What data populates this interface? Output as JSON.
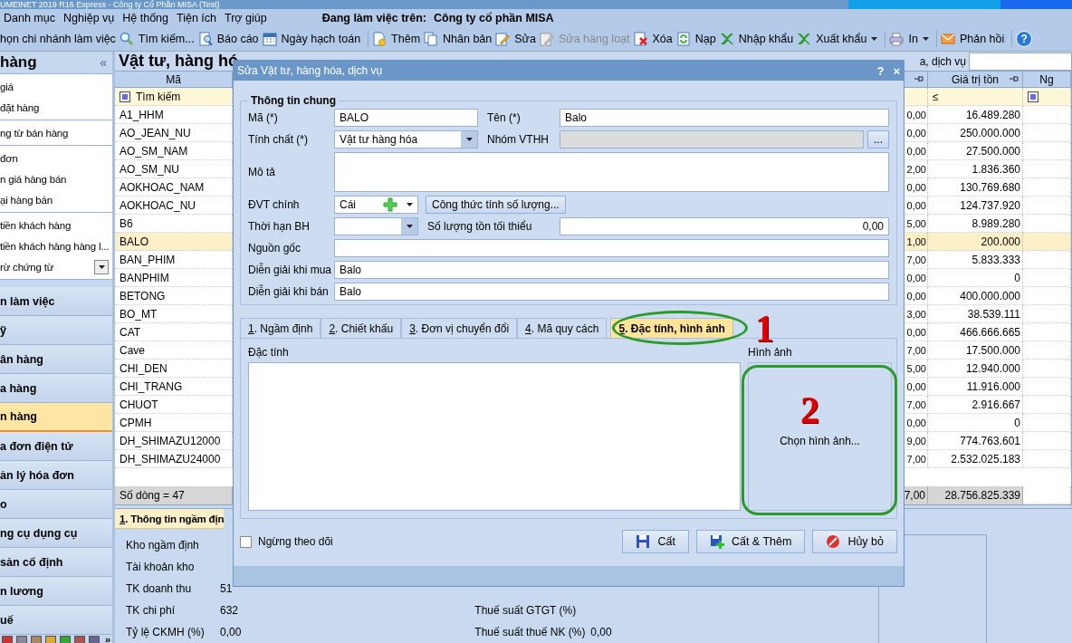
{
  "window": {
    "title": "UMEINET 2019 R16 Express - Công ty Cổ Phần MISA (Test)"
  },
  "menu": {
    "items": [
      "Danh mục",
      "Nghiệp vụ",
      "Hệ thống",
      "Tiện ích",
      "Trợ giúp"
    ],
    "working_label": "Đang làm việc trên:",
    "company": "Công ty cổ phần MISA"
  },
  "toolbar": {
    "items": [
      {
        "label": "họn chi nhánh làm việc",
        "disabled": false,
        "dropdown": false
      },
      {
        "label": "Tìm kiếm...",
        "disabled": false,
        "dropdown": false
      },
      {
        "label": "Báo cáo",
        "disabled": false,
        "dropdown": false
      },
      {
        "label": "Ngày hạch toán",
        "disabled": false,
        "dropdown": false
      },
      {
        "label": "Thêm",
        "disabled": false,
        "dropdown": false
      },
      {
        "label": "Nhân bản",
        "disabled": false,
        "dropdown": false
      },
      {
        "label": "Sửa",
        "disabled": false,
        "dropdown": false
      },
      {
        "label": "Sửa hàng loạt",
        "disabled": true,
        "dropdown": false
      },
      {
        "label": "Xóa",
        "disabled": false,
        "dropdown": false
      },
      {
        "label": "Nạp",
        "disabled": false,
        "dropdown": false
      },
      {
        "label": "Nhập khẩu",
        "disabled": false,
        "dropdown": false
      },
      {
        "label": "Xuất khẩu",
        "disabled": false,
        "dropdown": true
      },
      {
        "label": "In",
        "disabled": false,
        "dropdown": true
      },
      {
        "label": "Phản hồi",
        "disabled": false,
        "dropdown": false
      }
    ],
    "help": "?"
  },
  "sidebar": {
    "title": "hàng",
    "collapse": "«",
    "groups": [
      [
        "giá",
        "đặt hàng"
      ],
      [
        "ng từ bán hàng"
      ],
      [
        "đơn",
        "n giá hàng bán",
        "ại hàng bán"
      ],
      [
        "tiền khách hàng",
        "tiền khách hàng hàng l...",
        "rừ chứng từ"
      ]
    ],
    "nav": [
      {
        "label": "n làm việc",
        "selected": false
      },
      {
        "label": "ỹ",
        "selected": false
      },
      {
        "label": "ân hàng",
        "selected": false
      },
      {
        "label": "a hàng",
        "selected": false
      },
      {
        "label": "n hàng",
        "selected": true
      },
      {
        "label": "a đơn điện tử",
        "selected": false
      },
      {
        "label": "ản lý hóa đơn",
        "selected": false
      },
      {
        "label": "o",
        "selected": false
      },
      {
        "label": "ng cụ dụng cụ",
        "selected": false
      },
      {
        "label": "sản cố định",
        "selected": false
      },
      {
        "label": "n lương",
        "selected": false
      },
      {
        "label": "uế",
        "selected": false
      }
    ],
    "more": "»"
  },
  "grid": {
    "title": "Vật tư, hàng hó",
    "search_label": "a, dịch vụ",
    "columns": [
      "Mã",
      "Giá trị tồn",
      "Ng"
    ],
    "filter": {
      "search": "Tìm kiếm",
      "operator": "≤"
    },
    "rows": [
      {
        "code": "A1_HHM",
        "qty": "0,00",
        "value": "16.489.280",
        "selected": false
      },
      {
        "code": "AO_JEAN_NU",
        "qty": "0,00",
        "value": "250.000.000",
        "selected": false
      },
      {
        "code": "AO_SM_NAM",
        "qty": "0,00",
        "value": "27.500.000",
        "selected": false
      },
      {
        "code": "AO_SM_NU",
        "qty": "2,00",
        "value": "1.836.360",
        "selected": false
      },
      {
        "code": "AOKHOAC_NAM",
        "qty": "0,00",
        "value": "130.769.680",
        "selected": false
      },
      {
        "code": "AOKHOAC_NU",
        "qty": "0,00",
        "value": "124.737.920",
        "selected": false
      },
      {
        "code": "B6",
        "qty": "5,00",
        "value": "8.989.280",
        "selected": false
      },
      {
        "code": "BALO",
        "qty": "1,00",
        "value": "200.000",
        "selected": true
      },
      {
        "code": "BAN_PHIM",
        "qty": "7,00",
        "value": "5.833.333",
        "selected": false
      },
      {
        "code": "BANPHIM",
        "qty": "0,00",
        "value": "0",
        "selected": false
      },
      {
        "code": "BETONG",
        "qty": "0,00",
        "value": "400.000.000",
        "selected": false
      },
      {
        "code": "BO_MT",
        "qty": "3,00",
        "value": "38.539.111",
        "selected": false
      },
      {
        "code": "CAT",
        "qty": "0,00",
        "value": "466.666.665",
        "selected": false
      },
      {
        "code": "Cave",
        "qty": "7,00",
        "value": "17.500.000",
        "selected": false
      },
      {
        "code": "CHI_DEN",
        "qty": "5,00",
        "value": "12.940.000",
        "selected": false
      },
      {
        "code": "CHI_TRANG",
        "qty": "0,00",
        "value": "11.916.000",
        "selected": false
      },
      {
        "code": "CHUOT",
        "qty": "7,00",
        "value": "2.916.667",
        "selected": false
      },
      {
        "code": "CPMH",
        "qty": "0,00",
        "value": "0",
        "selected": false
      },
      {
        "code": "DH_SHIMAZU12000",
        "qty": "9,00",
        "value": "774.763.601",
        "selected": false
      },
      {
        "code": "DH_SHIMAZU24000",
        "qty": "7,00",
        "value": "2.532.025.183",
        "selected": false
      }
    ],
    "footer": {
      "count": "Số dòng = 47",
      "qty": "7,00",
      "value": "28.756.825.339"
    }
  },
  "detail": {
    "tab": "1. Thông tin ngầm địn",
    "left": [
      {
        "label": "Kho ngầm định"
      },
      {
        "label": "Tài khoản kho"
      },
      {
        "label": "TK doanh thu",
        "value": "51"
      },
      {
        "label": "TK chi phí",
        "value": "632"
      },
      {
        "label": "Tỷ lệ CKMH (%)",
        "value": "0,00"
      }
    ],
    "right": [
      {
        "label": "Thuế suất GTGT (%)"
      },
      {
        "label": "Thuế suất thuế NK (%)",
        "value": "0,00"
      }
    ]
  },
  "dialog": {
    "title": "Sửa Vật tư, hàng hóa, dịch vụ",
    "help": "?",
    "close": "×",
    "group": "Thông tin chung",
    "rows": [
      [
        {
          "label": "Mã (*)",
          "value": "BALO",
          "kind": "text"
        },
        {
          "label": "Tên (*)",
          "value": "Balo",
          "kind": "text"
        }
      ],
      [
        {
          "label": "Tính chất (*)",
          "value": "Vật tư hàng hóa",
          "kind": "combo"
        },
        {
          "label": "Nhóm VTHH",
          "kind": "picker",
          "button": "..."
        }
      ],
      [
        {
          "label": "Mô tả",
          "kind": "memo"
        }
      ],
      [
        {
          "label": "ĐVT chính",
          "value": "Cái",
          "kind": "unit"
        },
        {
          "button": "Công thức tính số lượng...",
          "kind": "button"
        }
      ],
      [
        {
          "label": "Thời hạn BH",
          "kind": "combo"
        },
        {
          "label": "Số lượng tồn tối thiểu",
          "value": "0,00",
          "kind": "number"
        }
      ],
      [
        {
          "label": "Nguồn gốc",
          "kind": "text"
        }
      ],
      [
        {
          "label": "Diễn giải khi mua",
          "value": "Balo",
          "kind": "text"
        }
      ],
      [
        {
          "label": "Diễn giải khi bán",
          "value": "Balo",
          "kind": "text"
        }
      ]
    ],
    "tabs": [
      {
        "label": "1. Ngầm định",
        "selected": false
      },
      {
        "label": "2. Chiết khấu",
        "selected": false
      },
      {
        "label": "3. Đơn vị chuyển đổi",
        "selected": false
      },
      {
        "label": "4. Mã quy cách",
        "selected": false
      },
      {
        "label": "5. Đặc tính, hình ảnh",
        "selected": true
      }
    ],
    "traits_label": "Đặc tính",
    "image_label": "Hình ảnh",
    "image_button": "Chọn hình ảnh...",
    "inactive": {
      "label": "Ngừng theo dõi",
      "checked": false
    },
    "buttons": [
      {
        "label": "Cất"
      },
      {
        "label": "Cất & Thêm"
      },
      {
        "label": "Hủy bỏ"
      }
    ],
    "annotations": [
      {
        "label": "1",
        "kind": "ellipse"
      },
      {
        "label": "2",
        "kind": "frame"
      }
    ]
  }
}
